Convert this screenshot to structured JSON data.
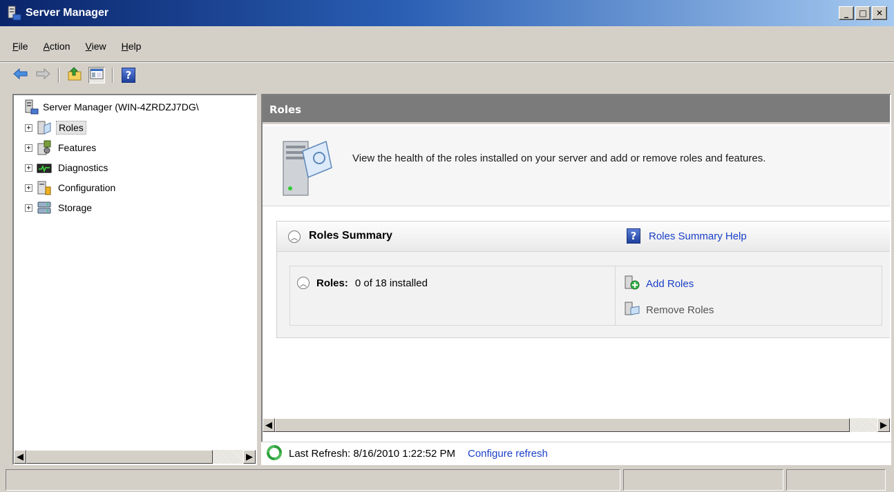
{
  "window": {
    "title": "Server Manager",
    "controls": {
      "minimize": "_",
      "maximize": "□",
      "close": "✕"
    }
  },
  "menu": {
    "items": [
      {
        "label": "File",
        "accel": "F",
        "rest": "ile"
      },
      {
        "label": "Action",
        "accel": "A",
        "rest": "ction"
      },
      {
        "label": "View",
        "accel": "V",
        "rest": "iew"
      },
      {
        "label": "Help",
        "accel": "H",
        "rest": "elp"
      }
    ]
  },
  "toolbar": {
    "buttons": [
      "back-arrow-icon",
      "forward-arrow-icon",
      "up-folder-icon",
      "show-hide-console-tree-icon",
      "help-icon"
    ]
  },
  "tree": {
    "root": "Server Manager (WIN-4ZRDZJ7DG\\",
    "items": [
      {
        "label": "Roles",
        "selected": true,
        "icon": "roles-icon"
      },
      {
        "label": "Features",
        "selected": false,
        "icon": "features-icon"
      },
      {
        "label": "Diagnostics",
        "selected": false,
        "icon": "diagnostics-icon"
      },
      {
        "label": "Configuration",
        "selected": false,
        "icon": "configuration-icon"
      },
      {
        "label": "Storage",
        "selected": false,
        "icon": "storage-icon"
      }
    ]
  },
  "content": {
    "header": "Roles",
    "description": "View the health of the roles installed on your server and add or remove roles and features.",
    "summary": {
      "title": "Roles Summary",
      "help_link": "Roles Summary Help",
      "roles_label": "Roles:",
      "roles_count": "0 of 18 installed",
      "actions": {
        "add": "Add Roles",
        "remove": "Remove Roles"
      }
    },
    "refresh": {
      "text": "Last Refresh: 8/16/2010 1:22:52 PM",
      "link": "Configure refresh"
    }
  },
  "colors": {
    "title_gradient_start": "#0a246a",
    "title_gradient_end": "#a6caf0",
    "header_bg": "#7b7b7b",
    "link": "#1a3fc7"
  }
}
